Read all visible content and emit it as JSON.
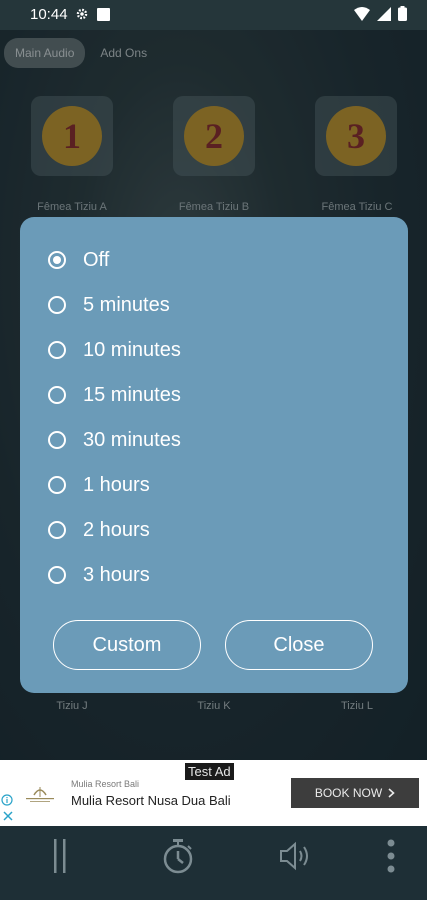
{
  "status_bar": {
    "time": "10:44"
  },
  "tabs": [
    {
      "label": "Main Audio",
      "active": true
    },
    {
      "label": "Add Ons",
      "active": false
    }
  ],
  "sounds_top": [
    {
      "number": "1",
      "label": "Fêmea Tiziu A"
    },
    {
      "number": "2",
      "label": "Fêmea Tiziu B"
    },
    {
      "number": "3",
      "label": "Fêmea Tiziu C"
    }
  ],
  "sounds_bottom": [
    {
      "label": "Tiziu J"
    },
    {
      "label": "Tiziu K"
    },
    {
      "label": "Tiziu L"
    }
  ],
  "timer_dialog": {
    "options": [
      {
        "label": "Off",
        "selected": true
      },
      {
        "label": "5 minutes",
        "selected": false
      },
      {
        "label": "10 minutes",
        "selected": false
      },
      {
        "label": "15 minutes",
        "selected": false
      },
      {
        "label": "30 minutes",
        "selected": false
      },
      {
        "label": "1 hours",
        "selected": false
      },
      {
        "label": "2 hours",
        "selected": false
      },
      {
        "label": "3 hours",
        "selected": false
      }
    ],
    "custom_label": "Custom",
    "close_label": "Close"
  },
  "ad": {
    "tag": "Test Ad",
    "advertiser": "Mulia Resort Bali",
    "headline": "Mulia Resort Nusa Dua Bali",
    "cta": "BOOK NOW"
  },
  "controls": {
    "icons": [
      "pause-icon",
      "timer-icon",
      "volume-icon",
      "more-vert-icon"
    ]
  },
  "colors": {
    "dialog_bg": "#6b9bb8",
    "sound_circle": "#d9a42c",
    "sound_number": "#9b2a2a"
  }
}
